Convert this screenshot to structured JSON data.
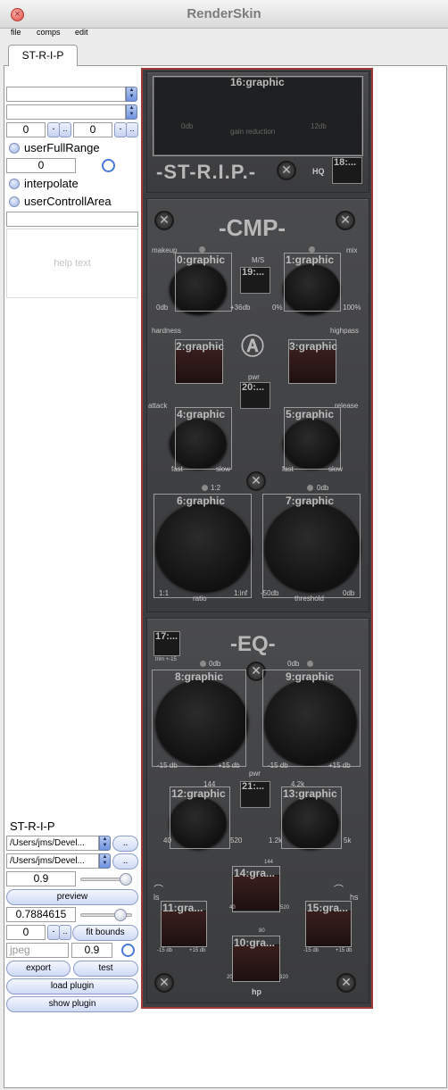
{
  "window": {
    "title": "RenderSkin"
  },
  "menu": [
    "file",
    "comps",
    "edit"
  ],
  "tab": "ST-R-I-P",
  "left": {
    "num1": "0",
    "num2": "0",
    "more": "..",
    "dash": "-",
    "userFullRange": "userFullRange",
    "num3": "0",
    "interpolate": "interpolate",
    "userControllArea": "userControllArea",
    "help": "help text",
    "name": "ST-R-I-P",
    "path1": "/Users/jms/Devel...",
    "path2": "/Users/jms/Devel...",
    "scale": "0.9",
    "preview": "preview",
    "zoom": "0.7884615",
    "num4": "0",
    "fit": "fit bounds",
    "format": "jpeg",
    "quality": "0.9",
    "export": "export",
    "test": "test",
    "load": "load plugin",
    "show": "show plugin"
  },
  "plugin": {
    "top": {
      "graphic": "16:graphic",
      "gr_label": "gain reduction",
      "zero": "0db",
      "twelve": "12db",
      "logo": "-ST-R.I.P.-",
      "hq": "HQ",
      "g18": "18:..."
    },
    "cmp": {
      "title": "-CMP-",
      "makeup": "makeup",
      "mix": "mix",
      "ms": "M/S",
      "g0": "0:graphic",
      "g1": "1:graphic",
      "g19": "19:...",
      "zerodb": "0db",
      "p36": "+36db",
      "zero_pct": "0%",
      "hundred": "100%",
      "hardness": "hardness",
      "highpass": "highpass",
      "g2": "2:graphic",
      "g3": "3:graphic",
      "pwr": "pwr",
      "g20": "20:...",
      "attack": "attack",
      "release": "release",
      "g4": "4:graphic",
      "g5": "5:graphic",
      "fast": "fast",
      "slow": "slow",
      "ratio_top": "1:2",
      "thr_top": "0db",
      "g6": "6:graphic",
      "g7": "7:graphic",
      "r11": "1:1",
      "rinf": "1:inf",
      "ratio": "ratio",
      "m50": "-50db",
      "threshold": "threshold",
      "t0": "0db"
    },
    "eq": {
      "title": "-EQ-",
      "g17": "17:...",
      "trim": "trim +-15",
      "z1": "0db",
      "z2": "0db",
      "g8": "8:graphic",
      "g9": "9:graphic",
      "m15": "-15 db",
      "p15": "+15 db",
      "pwr": "pwr",
      "f144": "144",
      "f42k": "4.2k",
      "g12": "12:graphic",
      "g21": "21:...",
      "g13": "13:graphic",
      "f40": "40",
      "f520": "520",
      "f12k": "1.2k",
      "f5k": "5k",
      "g14": "14:gra...",
      "f144b": "144",
      "ls": "ls",
      "hs": "hs",
      "g11": "11:gra...",
      "g15": "15:gra...",
      "f40b": "40",
      "f520b": "520",
      "m15s": "-15 db",
      "p15s": "+15 db",
      "f80": "80",
      "g10": "10:gra...",
      "f20": "20",
      "f320": "320",
      "hp": "hp"
    }
  }
}
